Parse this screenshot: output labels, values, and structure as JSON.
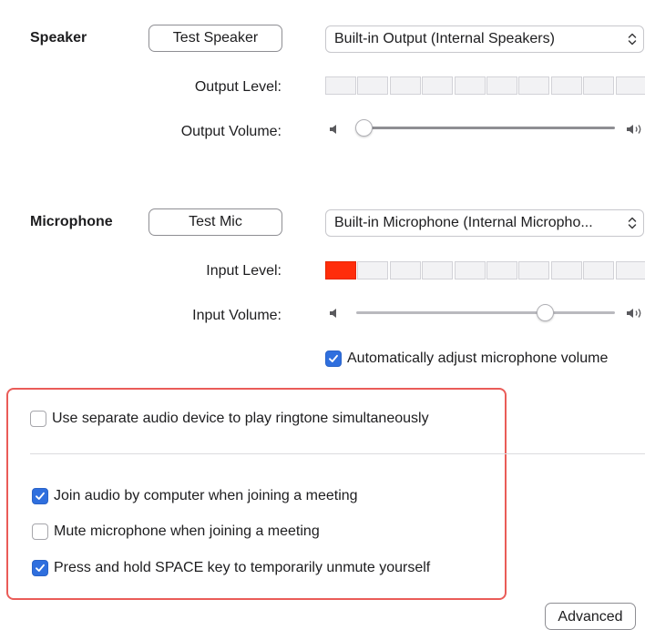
{
  "speaker": {
    "section_label": "Speaker",
    "test_button": "Test Speaker",
    "device": "Built-in Output (Internal Speakers)",
    "output_level_label": "Output Level:",
    "output_level_segments_lit": 0,
    "output_level_segments_total": 10,
    "output_volume_label": "Output Volume:",
    "output_volume_fraction": 0.03
  },
  "microphone": {
    "section_label": "Microphone",
    "test_button": "Test Mic",
    "device": "Built-in Microphone (Internal Micropho...",
    "input_level_label": "Input Level:",
    "input_level_segments_lit": 1,
    "input_level_segments_total": 10,
    "input_volume_label": "Input Volume:",
    "input_volume_fraction": 0.73
  },
  "options": {
    "auto_adjust": {
      "label": "Automatically adjust microphone volume",
      "checked": true
    },
    "separate_ringtone": {
      "label": "Use separate audio device to play ringtone simultaneously",
      "checked": false
    },
    "join_by_computer": {
      "label": "Join audio by computer when joining a meeting",
      "checked": true
    },
    "mute_on_join": {
      "label": "Mute microphone when joining a meeting",
      "checked": false
    },
    "press_space_unmute": {
      "label": "Press and hold SPACE key to temporarily unmute yourself",
      "checked": true
    }
  },
  "advanced_button": "Advanced",
  "colors": {
    "accent": "#2f6fde",
    "level_active": "#ff2d0a",
    "highlight_border": "#ea5c58"
  },
  "icons": {
    "volume_low": "speaker-low-icon",
    "volume_high": "speaker-high-icon",
    "select_chevron": "chevron-up-down-icon",
    "checkmark": "checkmark-icon"
  }
}
